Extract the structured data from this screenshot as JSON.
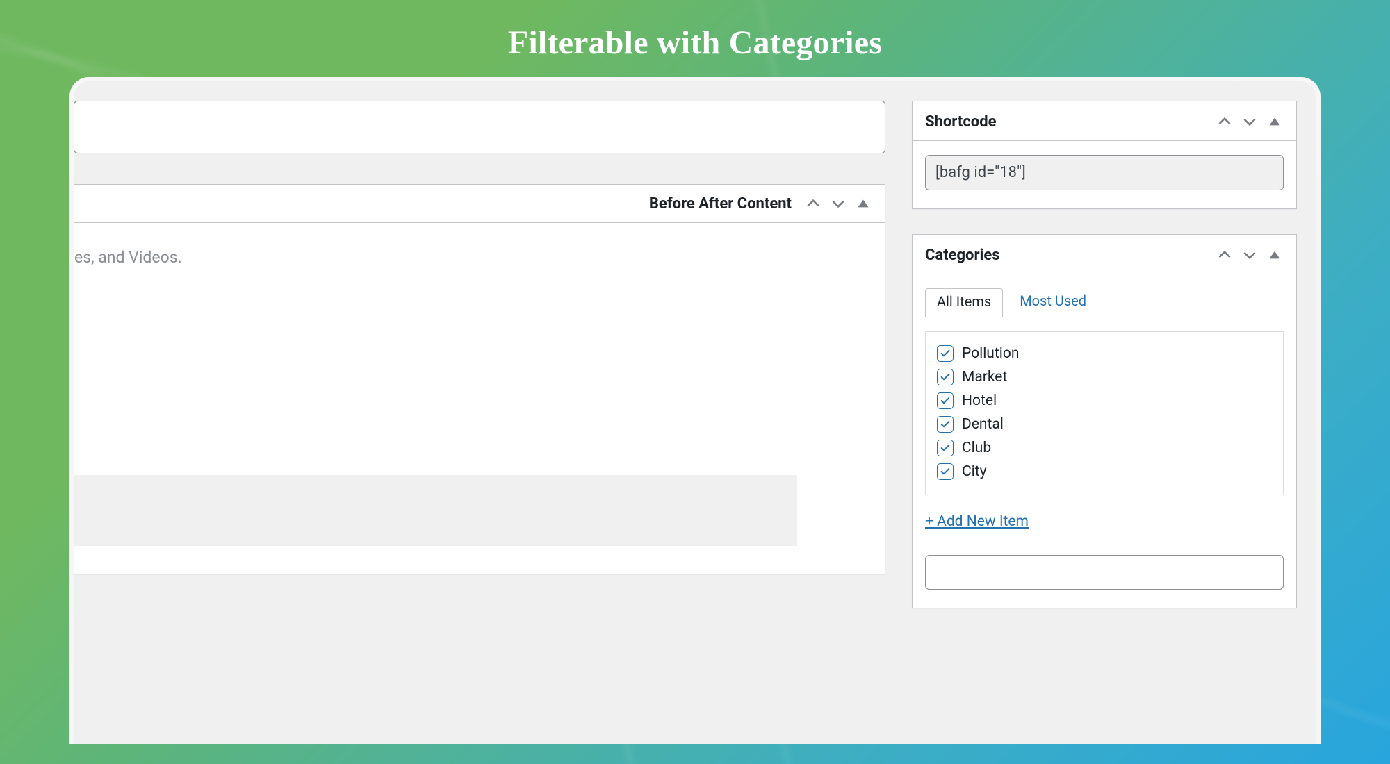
{
  "page_title": "Filterable with Categories",
  "main": {
    "content_box": {
      "title": "Before After Content",
      "body_fragment": "es, and Videos."
    }
  },
  "sidebar": {
    "shortcode": {
      "title": "Shortcode",
      "value": "[bafg id=\"18\"]"
    },
    "categories": {
      "title": "Categories",
      "tab_all": "All Items",
      "tab_most": "Most Used",
      "items": [
        {
          "label": "Pollution",
          "checked": true
        },
        {
          "label": "Market",
          "checked": true
        },
        {
          "label": "Hotel",
          "checked": true
        },
        {
          "label": "Dental",
          "checked": true
        },
        {
          "label": "Club",
          "checked": true
        },
        {
          "label": "City",
          "checked": true
        }
      ],
      "add_new_label": "+ Add New Item"
    }
  }
}
